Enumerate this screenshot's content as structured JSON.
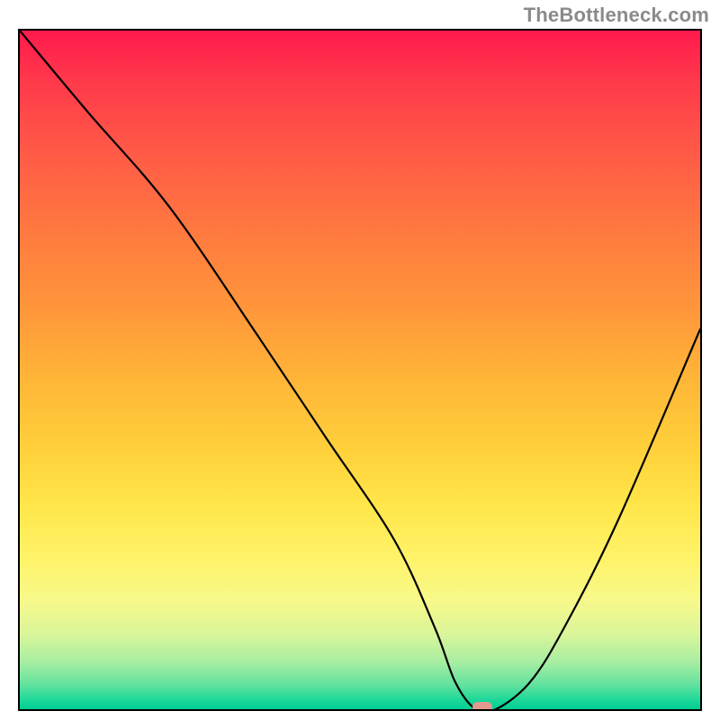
{
  "attribution": "TheBottleneck.com",
  "chart_data": {
    "type": "line",
    "title": "",
    "xlabel": "",
    "ylabel": "",
    "xlim": [
      0,
      100
    ],
    "ylim": [
      0,
      100
    ],
    "grid": false,
    "legend": false,
    "curve_note": "V-shaped bottleneck curve; y-values are estimated from pixel positions relative to frame.",
    "x": [
      0,
      10,
      22,
      35,
      45,
      55,
      61,
      64,
      67,
      70,
      75,
      80,
      88,
      100
    ],
    "y": [
      100,
      88,
      74,
      55,
      40,
      25,
      12,
      4,
      0,
      0,
      4,
      12,
      28,
      56
    ],
    "optimum_marker": {
      "x": 68,
      "y": 0,
      "color": "#e2998f"
    }
  }
}
